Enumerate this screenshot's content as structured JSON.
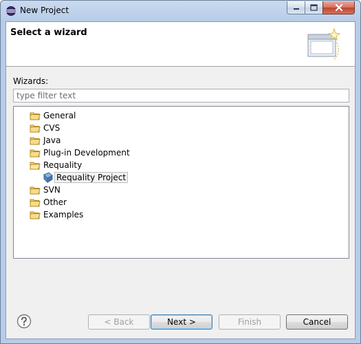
{
  "window": {
    "title": "New Project",
    "controls": {
      "minimize": "minimize",
      "maximize": "maximize",
      "close": "close"
    }
  },
  "banner": {
    "title": "Select a wizard"
  },
  "wizards": {
    "label": "Wizards:",
    "filter_placeholder": "type filter text",
    "filter_value": "",
    "tree": [
      {
        "label": "General",
        "type": "folder",
        "expanded": false
      },
      {
        "label": "CVS",
        "type": "folder",
        "expanded": false
      },
      {
        "label": "Java",
        "type": "folder",
        "expanded": false
      },
      {
        "label": "Plug-in Development",
        "type": "folder",
        "expanded": false
      },
      {
        "label": "Requality",
        "type": "folder",
        "expanded": true
      },
      {
        "label": "Requality Project",
        "type": "project",
        "selected": true
      },
      {
        "label": "SVN",
        "type": "folder",
        "expanded": false
      },
      {
        "label": "Other",
        "type": "folder",
        "expanded": false
      },
      {
        "label": "Examples",
        "type": "folder",
        "expanded": false
      }
    ]
  },
  "buttons": {
    "back": "< Back",
    "next": "Next >",
    "finish": "Finish",
    "cancel": "Cancel"
  },
  "colors": {
    "folder": "#e8b646",
    "selection": "#f2f2f2",
    "default_button_border": "#3c7fb1"
  }
}
